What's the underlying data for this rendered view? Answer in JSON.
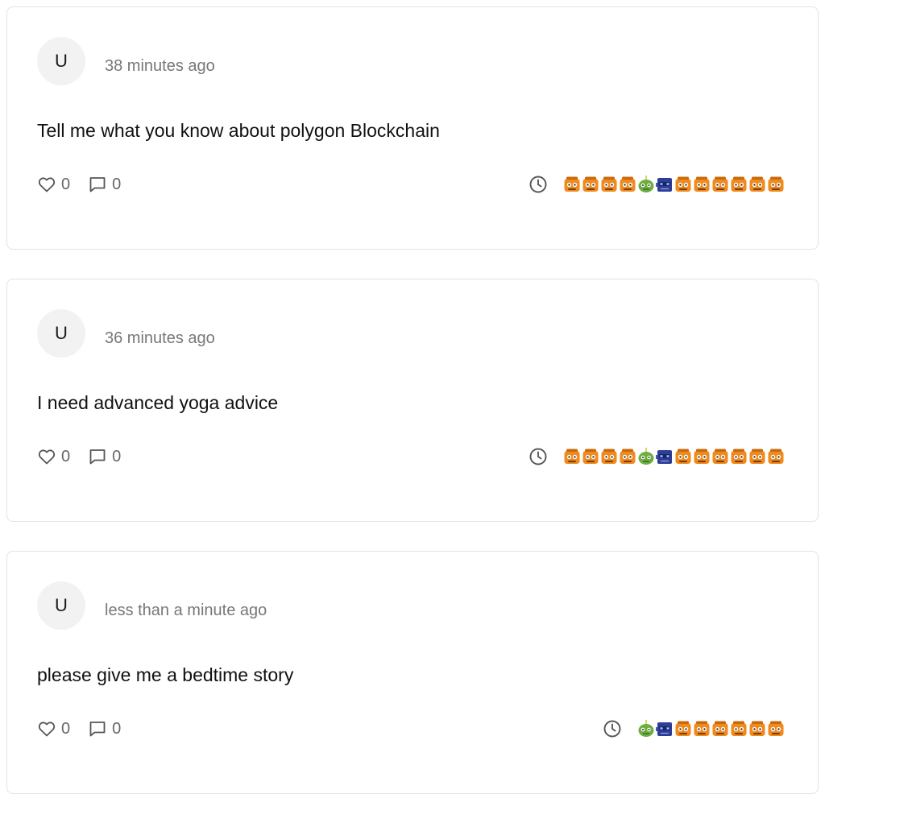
{
  "posts": [
    {
      "avatar_initial": "U",
      "time": "38 minutes ago",
      "message": "Tell me what you know about polygon Blockchain",
      "likes": "0",
      "comments": "0",
      "bots": [
        "orange",
        "orange",
        "orange",
        "orange",
        "green",
        "blue",
        "orange",
        "orange",
        "orange",
        "orange",
        "orange",
        "orange"
      ]
    },
    {
      "avatar_initial": "U",
      "time": "36 minutes ago",
      "message": "I need advanced yoga advice",
      "likes": "0",
      "comments": "0",
      "bots": [
        "orange",
        "orange",
        "orange",
        "orange",
        "green",
        "blue",
        "orange",
        "orange",
        "orange",
        "orange",
        "orange",
        "orange"
      ]
    },
    {
      "avatar_initial": "U",
      "time": "less than a minute ago",
      "message": "please give me a bedtime story",
      "likes": "0",
      "comments": "0",
      "bots": [
        "green",
        "blue",
        "orange",
        "orange",
        "orange",
        "orange",
        "orange",
        "orange"
      ]
    }
  ],
  "colors": {
    "orange": "#f08a1c",
    "green": "#6cae3f",
    "blue": "#2f3d9a",
    "icon": "#555555"
  },
  "icons": {
    "like": "heart-icon",
    "comment": "comment-icon",
    "time": "clock-icon",
    "bot": "robot-icon"
  }
}
